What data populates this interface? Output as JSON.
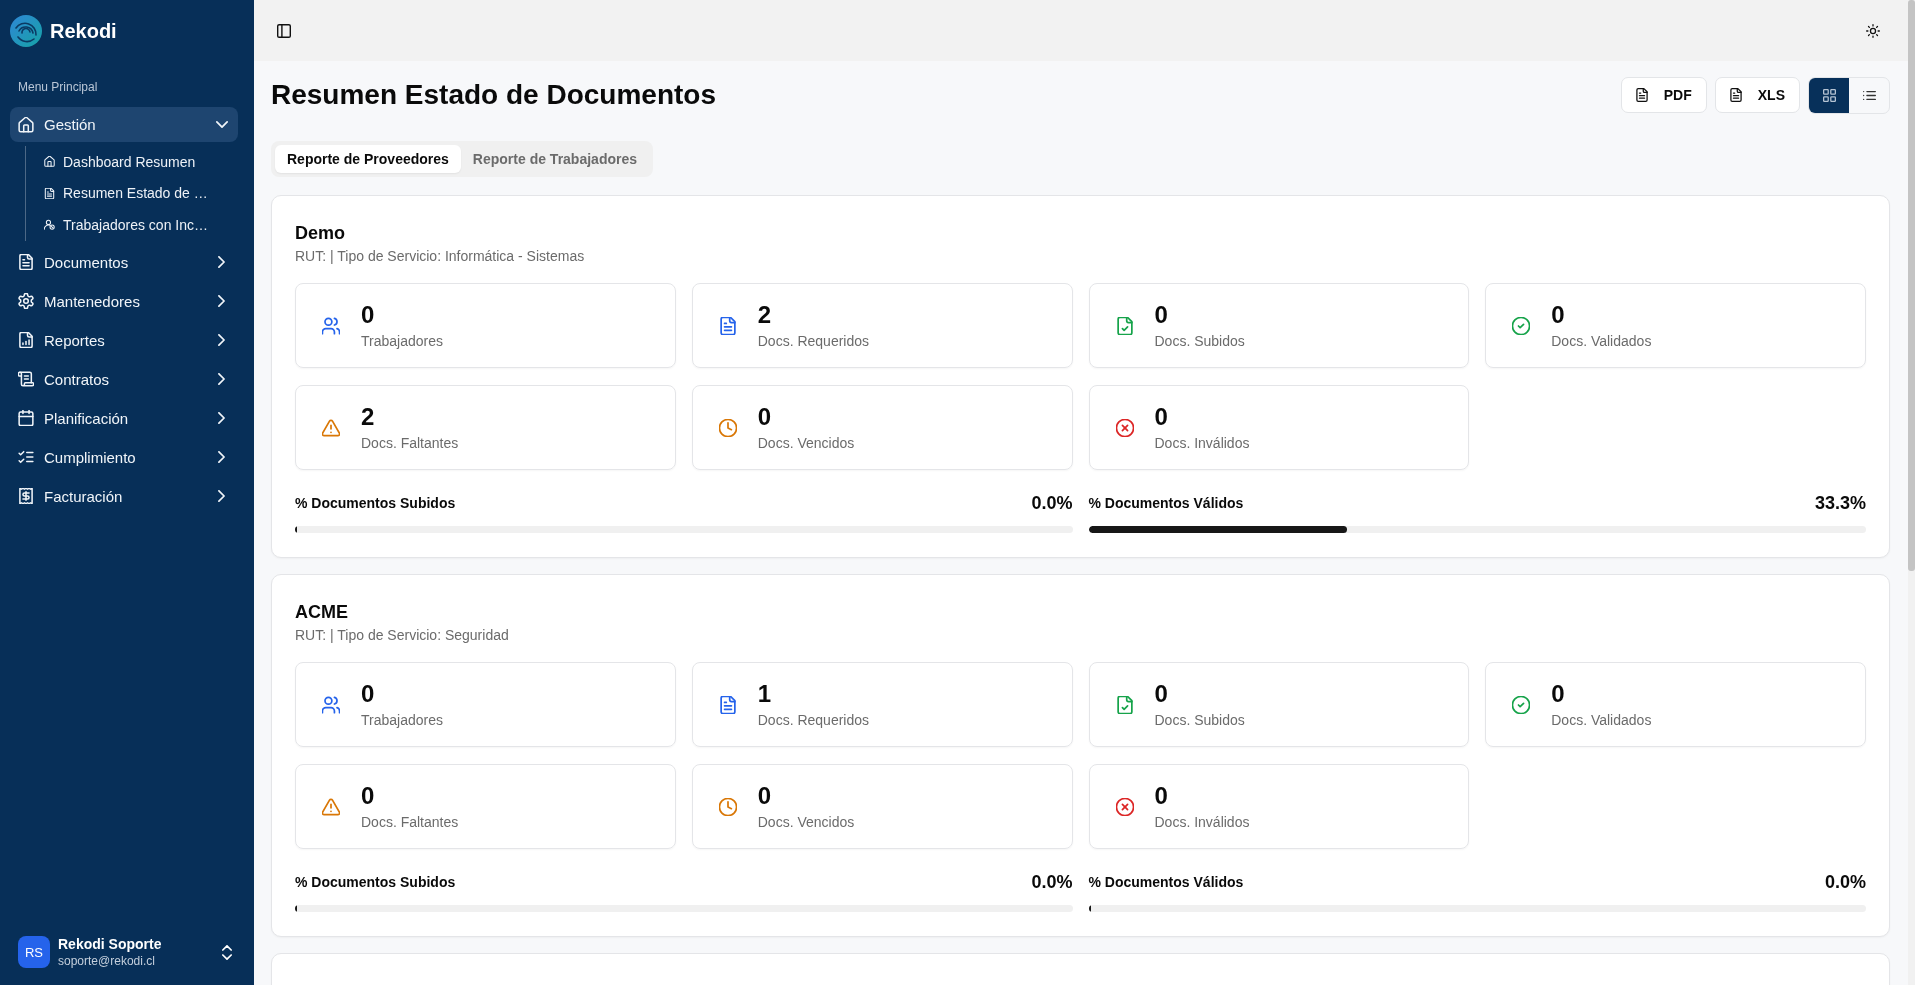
{
  "sidebar": {
    "brand": "Rekodi",
    "section_label": "Menu Principal",
    "items": [
      {
        "label": "Gestión",
        "selected": true,
        "expanded": true,
        "children": [
          {
            "label": "Dashboard Resumen",
            "selected": false
          },
          {
            "label": "Resumen Estado de …",
            "selected": false
          },
          {
            "label": "Trabajadores con Inc…",
            "selected": false
          }
        ]
      },
      {
        "label": "Documentos",
        "selected": false,
        "expanded": false
      },
      {
        "label": "Mantenedores",
        "selected": false,
        "expanded": false
      },
      {
        "label": "Reportes",
        "selected": false,
        "expanded": false
      },
      {
        "label": "Contratos",
        "selected": false,
        "expanded": false
      },
      {
        "label": "Planificación",
        "selected": false,
        "expanded": false
      },
      {
        "label": "Cumplimiento",
        "selected": false,
        "expanded": false
      },
      {
        "label": "Facturación",
        "selected": false,
        "expanded": false
      }
    ],
    "user": {
      "initials": "RS",
      "name": "Rekodi Soporte",
      "email": "soporte@rekodi.cl"
    }
  },
  "page": {
    "title": "Resumen Estado de Documentos",
    "export_buttons": [
      {
        "label": "PDF"
      },
      {
        "label": "XLS"
      }
    ],
    "view_modes": [
      {
        "selected": true
      },
      {
        "selected": false
      }
    ]
  },
  "tabs": [
    {
      "label": "Reporte de Proveedores",
      "selected": true
    },
    {
      "label": "Reporte de Trabajadores",
      "selected": false
    }
  ],
  "cards": [
    {
      "cut_off": false,
      "name": "Demo",
      "subtitle": "RUT: | Tipo de Servicio: Informática - Sistemas",
      "stats": [
        {
          "value": "0",
          "label": "Trabajadores",
          "color": "#2563eb"
        },
        {
          "value": "2",
          "label": "Docs. Requeridos",
          "color": "#2563eb"
        },
        {
          "value": "0",
          "label": "Docs. Subidos",
          "color": "#16a34a"
        },
        {
          "value": "0",
          "label": "Docs. Validados",
          "color": "#16a34a"
        },
        {
          "value": "2",
          "label": "Docs. Faltantes",
          "color": "#d97706"
        },
        {
          "value": "0",
          "label": "Docs. Vencidos",
          "color": "#d97706"
        },
        {
          "value": "0",
          "label": "Docs. Inválidos",
          "color": "#dc2626"
        }
      ],
      "progress": [
        {
          "label": "% Documentos Subidos",
          "reading": "0.0%",
          "level": 0
        },
        {
          "label": "% Documentos Válidos",
          "reading": "33.3%",
          "level": 0.333
        }
      ]
    },
    {
      "cut_off": false,
      "name": "ACME",
      "subtitle": "RUT: | Tipo de Servicio: Seguridad",
      "stats": [
        {
          "value": "0",
          "label": "Trabajadores",
          "color": "#2563eb"
        },
        {
          "value": "1",
          "label": "Docs. Requeridos",
          "color": "#2563eb"
        },
        {
          "value": "0",
          "label": "Docs. Subidos",
          "color": "#16a34a"
        },
        {
          "value": "0",
          "label": "Docs. Validados",
          "color": "#16a34a"
        },
        {
          "value": "0",
          "label": "Docs. Faltantes",
          "color": "#d97706"
        },
        {
          "value": "0",
          "label": "Docs. Vencidos",
          "color": "#d97706"
        },
        {
          "value": "0",
          "label": "Docs. Inválidos",
          "color": "#dc2626"
        }
      ],
      "progress": [
        {
          "label": "% Documentos Subidos",
          "reading": "0.0%",
          "level": 0
        },
        {
          "label": "% Documentos Válidos",
          "reading": "0.0%",
          "level": 0
        }
      ]
    },
    {
      "cut_off": true
    }
  ]
}
